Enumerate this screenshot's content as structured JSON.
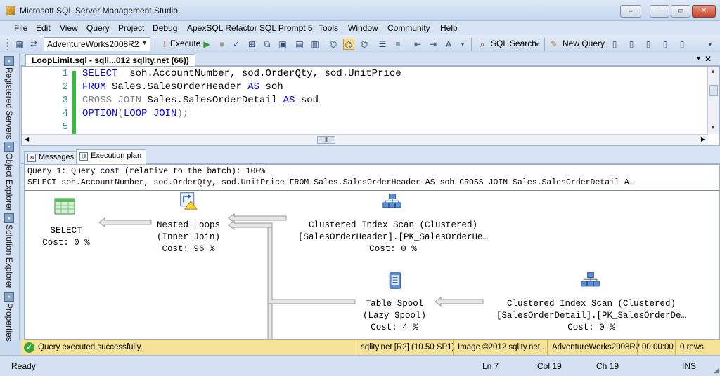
{
  "window": {
    "title": "Microsoft SQL Server Management Studio"
  },
  "menu": [
    "File",
    "Edit",
    "View",
    "Query",
    "Project",
    "Debug",
    "ApexSQL Refactor",
    "SQL Prompt 5",
    "Tools",
    "Window",
    "Community",
    "Help"
  ],
  "toolbar": {
    "database": "AdventureWorks2008R2",
    "execute_label": "Execute",
    "sql_search_label": "SQL Search",
    "new_query_label": "New Query"
  },
  "side_panels": [
    "Registered Servers",
    "Object Explorer",
    "Solution Explorer",
    "Properties"
  ],
  "document_tab": {
    "title": "LoopLimit.sql - sqli...012 sqlity.net (66))"
  },
  "editor": {
    "line_numbers": [
      "1",
      "2",
      "3",
      "4",
      "5"
    ],
    "lines": [
      [
        {
          "t": "SELECT",
          "c": "kw"
        },
        {
          "t": "  soh.AccountNumber, sod.OrderQty, sod.UnitPrice",
          "c": "tx"
        }
      ],
      [
        {
          "t": "FROM",
          "c": "kw"
        },
        {
          "t": " Sales.SalesOrderHeader ",
          "c": "tx"
        },
        {
          "t": "AS",
          "c": "kw"
        },
        {
          "t": " soh",
          "c": "tx"
        }
      ],
      [
        {
          "t": "CROSS JOIN",
          "c": "gr"
        },
        {
          "t": " Sales.SalesOrderDetail ",
          "c": "tx"
        },
        {
          "t": "AS",
          "c": "kw"
        },
        {
          "t": " sod",
          "c": "tx"
        }
      ],
      [
        {
          "t": "OPTION",
          "c": "kw"
        },
        {
          "t": "(",
          "c": "gr"
        },
        {
          "t": "LOOP JOIN",
          "c": "kw"
        },
        {
          "t": ");",
          "c": "gr"
        }
      ],
      []
    ]
  },
  "results_tabs": {
    "messages": "Messages",
    "execution_plan": "Execution plan"
  },
  "plan": {
    "query_cost": "Query 1: Query cost (relative to the batch): 100%",
    "query_text": "SELECT soh.AccountNumber, sod.OrderQty, sod.UnitPrice FROM Sales.SalesOrderHeader AS soh CROSS JOIN Sales.SalesOrderDetail A…",
    "nodes": {
      "select": {
        "l1": "SELECT",
        "l2": "Cost: 0 %"
      },
      "nested_loops": {
        "l1": "Nested Loops",
        "l2": "(Inner Join)",
        "l3": "Cost: 96 %"
      },
      "ci_scan_header": {
        "l1": "Clustered Index Scan (Clustered)",
        "l2": "[SalesOrderHeader].[PK_SalesOrderHe…",
        "l3": "Cost: 0 %"
      },
      "table_spool": {
        "l1": "Table Spool",
        "l2": "(Lazy Spool)",
        "l3": "Cost: 4 %"
      },
      "ci_scan_detail": {
        "l1": "Clustered Index Scan (Clustered)",
        "l2": "[SalesOrderDetail].[PK_SalesOrderDe…",
        "l3": "Cost: 0 %"
      }
    }
  },
  "status": {
    "message": "Query executed successfully.",
    "server": "sqlity.net [R2] (10.50 SP1)",
    "image": "Image ©2012 sqlity.net...",
    "database": "AdventureWorks2008R2",
    "time": "00:00:00",
    "rows": "0 rows"
  },
  "bottom": {
    "ready": "Ready",
    "ln": "Ln 7",
    "col": "Col 19",
    "ch": "Ch 19",
    "mode": "INS"
  }
}
